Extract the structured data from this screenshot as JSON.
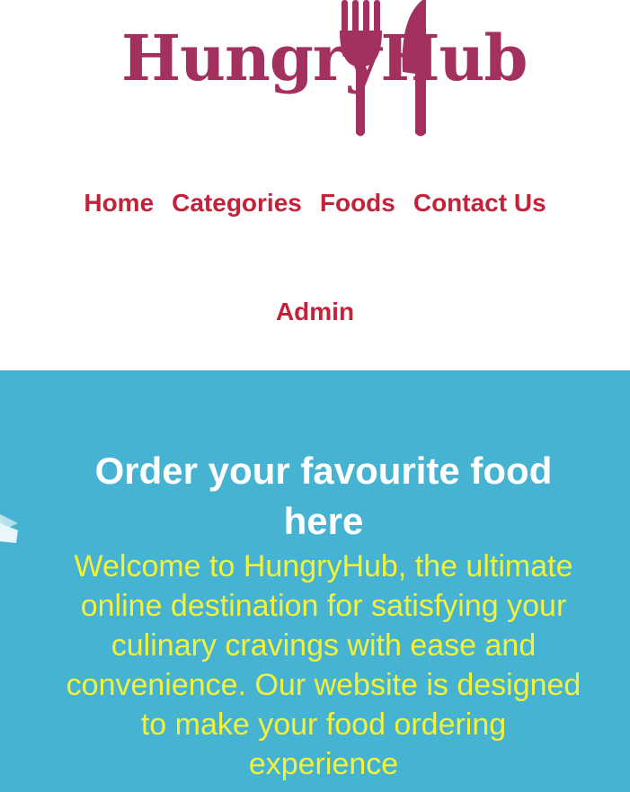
{
  "brand": {
    "name": "HungryHub",
    "color": "#a3315f"
  },
  "nav": {
    "items": [
      {
        "label": "Home"
      },
      {
        "label": "Categories"
      },
      {
        "label": "Foods"
      },
      {
        "label": "Contact Us"
      }
    ],
    "admin_label": "Admin",
    "link_color": "#c4213a"
  },
  "hero": {
    "title": "Order your favourite food here",
    "description": "Welcome to HungryHub, the ultimate online destination for satisfying your culinary cravings with ease and convenience. Our website is designed to make your food ordering experience",
    "background_color": "#45b3d1",
    "title_color": "#ffffff",
    "text_color": "#f2f23a"
  },
  "icons": {
    "logo_utensils": "fork-and-knife-icon"
  }
}
